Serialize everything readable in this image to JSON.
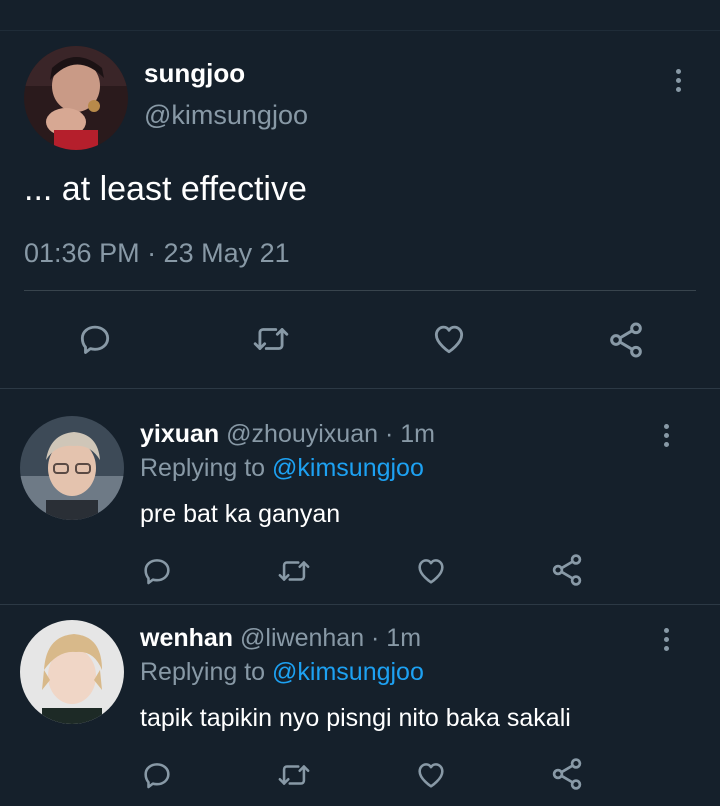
{
  "main_tweet": {
    "author_name": "sungjoo",
    "author_handle": "@kimsungjoo",
    "text": "... at least effective",
    "timestamp": "01:36 PM · 23 May 21",
    "avatar_icon": "avatar-photo"
  },
  "replies": [
    {
      "author_name": "yixuan",
      "author_handle": "@zhouyixuan · 1m",
      "replying_prefix": "Replying to ",
      "replying_to": "@kimsungjoo",
      "text": "pre bat ka ganyan"
    },
    {
      "author_name": "wenhan",
      "author_handle": "@liwenhan · 1m",
      "replying_prefix": "Replying to ",
      "replying_to": "@kimsungjoo",
      "text": "tapik tapikin nyo pisngi nito baka sakali"
    }
  ],
  "icons": {
    "reply": "speech-bubble-icon",
    "retweet": "retweet-arrows-icon",
    "like": "heart-icon",
    "share": "share-nodes-icon",
    "more": "vertical-dots-icon"
  },
  "colors": {
    "background": "#15202b",
    "text_primary": "#ffffff",
    "text_secondary": "#8899a6",
    "link": "#1da1f2",
    "divider": "#38444d"
  }
}
